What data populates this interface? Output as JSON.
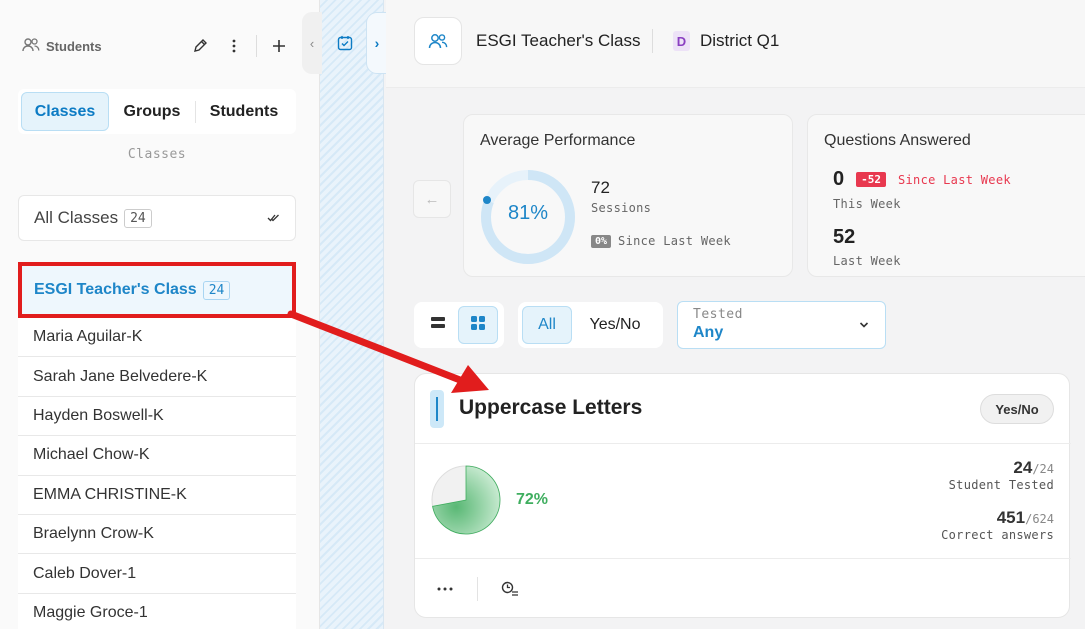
{
  "sidebar": {
    "title": "Students",
    "tabs": [
      {
        "label": "Classes",
        "active": true
      },
      {
        "label": "Groups",
        "active": false
      },
      {
        "label": "Students",
        "active": false
      }
    ],
    "tab_caption": "Classes",
    "all_classes": {
      "label": "All Classes",
      "count": "24"
    },
    "selected_class": {
      "label": "ESGI Teacher's Class",
      "count": "24"
    },
    "students": [
      "Maria Aguilar-K",
      "Sarah Jane Belvedere-K",
      "Hayden Boswell-K",
      "Michael Chow-K",
      "EMMA CHRISTINE-K",
      "Braelynn Crow-K",
      "Caleb Dover-1",
      "Maggie Groce-1"
    ]
  },
  "header": {
    "class_name": "ESGI Teacher's Class",
    "district_badge": "D",
    "district_name": "District Q1"
  },
  "avg_performance": {
    "title": "Average Performance",
    "percent": 81,
    "percent_label": "81%",
    "sessions_count": "72",
    "sessions_label": "Sessions",
    "change_chip": "0%",
    "change_label": "Since Last Week"
  },
  "questions_answered": {
    "title": "Questions Answered",
    "this_week_value": "0",
    "change_chip": "-52",
    "change_label": "Since Last Week",
    "this_week_label": "This Week",
    "last_week_value": "52",
    "last_week_label": "Last Week"
  },
  "filters": {
    "type_options": [
      {
        "label": "All",
        "active": true
      },
      {
        "label": "Yes/No",
        "active": false
      }
    ],
    "tested_label": "Tested",
    "tested_value": "Any"
  },
  "test_card": {
    "title": "Uppercase Letters",
    "type_badge": "Yes/No",
    "percent": 72,
    "percent_label": "72%",
    "students_tested": "24",
    "students_total": "/24",
    "students_tested_label": "Student Tested",
    "correct_answers": "451",
    "total_answers": "/624",
    "correct_answers_label": "Correct answers"
  },
  "colors": {
    "accent": "#1e86c8",
    "success": "#3fae5f",
    "danger": "#e8384f",
    "annotation": "#e11d1d"
  }
}
